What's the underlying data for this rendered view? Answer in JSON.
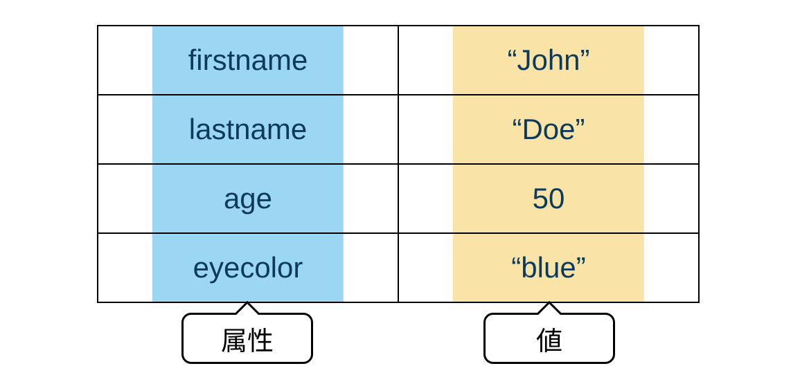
{
  "rows": [
    {
      "attr": "firstname",
      "val": "“John”"
    },
    {
      "attr": "lastname",
      "val": "“Doe”"
    },
    {
      "attr": "age",
      "val": "50"
    },
    {
      "attr": "eyecolor",
      "val": "“blue”"
    }
  ],
  "labels": {
    "attribute": "属性",
    "value": "値"
  },
  "colors": {
    "attr_highlight": "#9bd7f2",
    "val_highlight": "#fae3a6",
    "text": "#0e3a5a"
  }
}
